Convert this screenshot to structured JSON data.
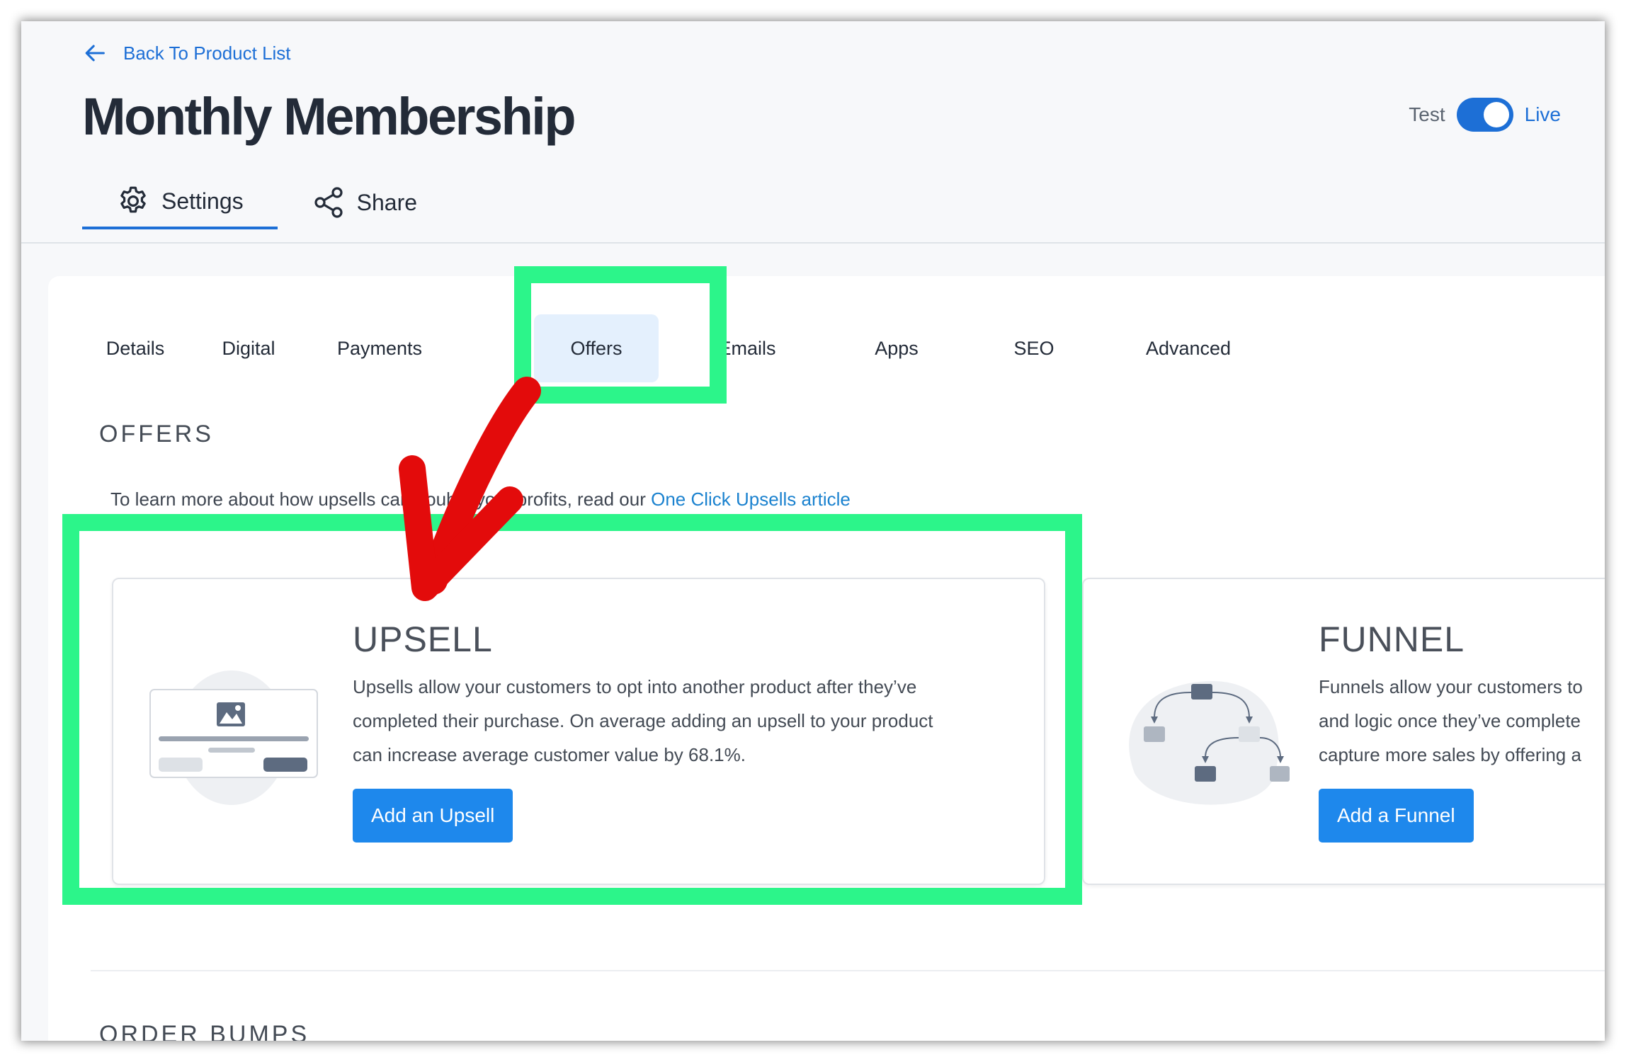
{
  "header": {
    "back_link": "Back To Product List",
    "title": "Monthly Membership",
    "mode_test_label": "Test",
    "mode_live_label": "Live",
    "tabs": [
      {
        "label": "Settings",
        "icon": "gear-icon"
      },
      {
        "label": "Share",
        "icon": "share-icon"
      }
    ]
  },
  "sub_tabs": [
    "Details",
    "Digital",
    "Payments",
    "Offers",
    "Emails",
    "Apps",
    "SEO",
    "Advanced"
  ],
  "active_sub_tab": "Offers",
  "offers": {
    "heading": "OFFERS",
    "intro_text": "To learn more about how upsells can double your profits, read our ",
    "intro_link": "One Click Upsells article",
    "cards": {
      "upsell": {
        "title": "UPSELL",
        "desc": [
          "Upsells allow your customers to opt into another product after they’ve",
          "completed their purchase. On average adding an upsell to your product",
          "can increase average customer value by 68.1%."
        ],
        "button": "Add an Upsell"
      },
      "funnel": {
        "title": "FUNNEL",
        "desc": [
          "Funnels allow your customers to",
          "and logic once they’ve complete",
          "capture more sales by offering a"
        ],
        "button": "Add a Funnel"
      }
    }
  },
  "order_bumps": {
    "heading": "ORDER BUMPS"
  },
  "colors": {
    "accent": "#1d6fd6",
    "button": "#1e88ec",
    "active_tab_bg": "#e4f0fd",
    "highlight": "#2cf58a",
    "annotation_arrow": "#e30b0b"
  }
}
